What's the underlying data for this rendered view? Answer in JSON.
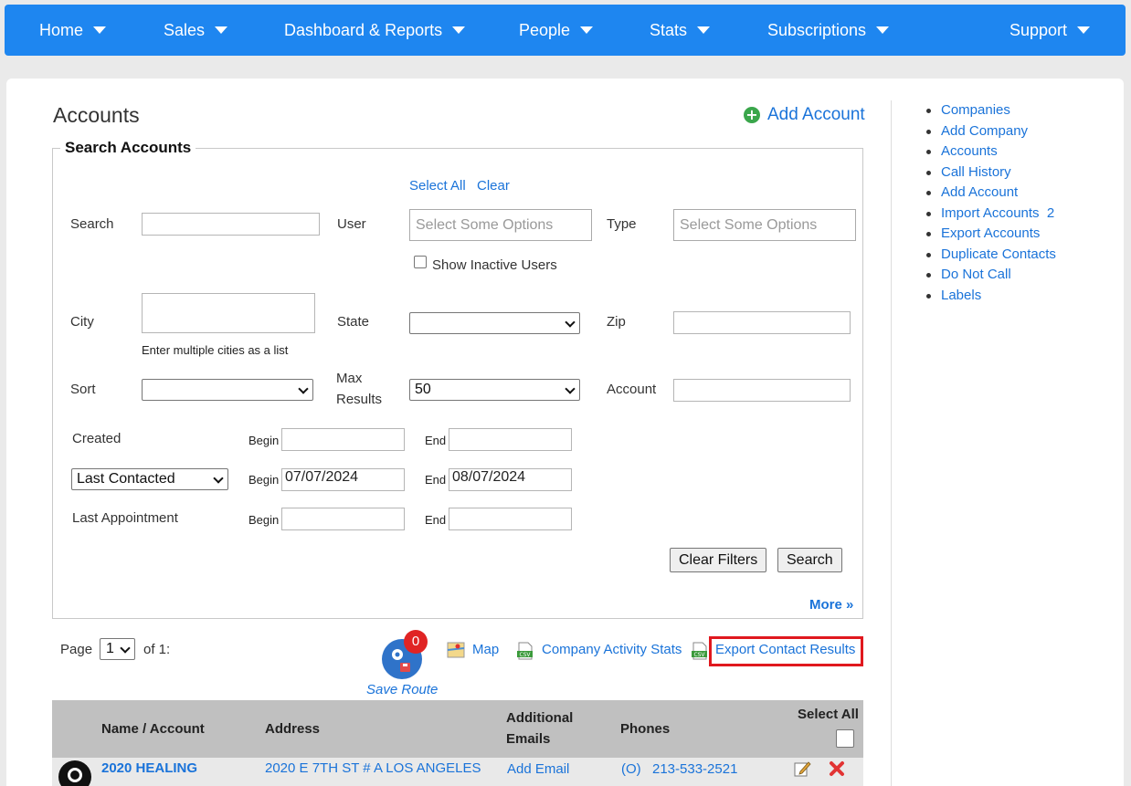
{
  "nav": {
    "items": [
      {
        "label": "Home"
      },
      {
        "label": "Sales"
      },
      {
        "label": "Dashboard & Reports"
      },
      {
        "label": "People"
      },
      {
        "label": "Stats"
      },
      {
        "label": "Subscriptions"
      },
      {
        "label": "Support"
      }
    ]
  },
  "page": {
    "title": "Accounts",
    "add_account": "Add Account"
  },
  "search": {
    "legend": "Search Accounts",
    "select_all": "Select All",
    "clear": "Clear",
    "search_label": "Search",
    "user_label": "User",
    "user_placeholder": "Select Some Options",
    "type_label": "Type",
    "type_placeholder": "Select Some Options",
    "show_inactive": "Show Inactive Users",
    "city_label": "City",
    "city_hint": "Enter multiple cities as a list",
    "state_label": "State",
    "zip_label": "Zip",
    "sort_label": "Sort",
    "max_results_label_1": "Max",
    "max_results_label_2": "Results",
    "max_results_value": "50",
    "account_label": "Account",
    "created_label": "Created",
    "begin": "Begin",
    "end": "End",
    "last_contacted_select": "Last Contacted",
    "last_contacted_begin": "07/07/2024",
    "last_contacted_end": "08/07/2024",
    "last_appointment_label": "Last Appointment",
    "clear_filters": "Clear Filters",
    "search_button": "Search",
    "more": "More »"
  },
  "sidebar": {
    "items": [
      {
        "label": "Companies"
      },
      {
        "label": "Add Company"
      },
      {
        "label": "Accounts"
      },
      {
        "label": "Call History"
      },
      {
        "label": "Add Account"
      },
      {
        "label": "Import Accounts  2"
      },
      {
        "label": "Export Accounts"
      },
      {
        "label": "Duplicate Contacts"
      },
      {
        "label": "Do Not Call"
      },
      {
        "label": "Labels"
      }
    ]
  },
  "toolbar": {
    "page_label": "Page",
    "page_value": "1",
    "of_label": "of 1:",
    "route_count": "0",
    "save_route": "Save Route",
    "map": "Map",
    "company_activity": "Company Activity Stats",
    "export_contact": "Export Contact Results"
  },
  "table": {
    "headers": {
      "name": "Name / Account",
      "address": "Address",
      "emails_1": "Additional",
      "emails_2": "Emails",
      "phones": "Phones",
      "select_all": "Select All"
    },
    "rows": [
      {
        "name": "2020 HEALING",
        "address": "2020 E 7TH ST # A LOS ANGELES",
        "email_action": "Add Email",
        "phone_type": "(O)",
        "phone": "213-533-2521"
      }
    ]
  },
  "colors": {
    "nav_bg": "#1e86f0",
    "link": "#1a73d9",
    "highlight": "#e0181e"
  }
}
